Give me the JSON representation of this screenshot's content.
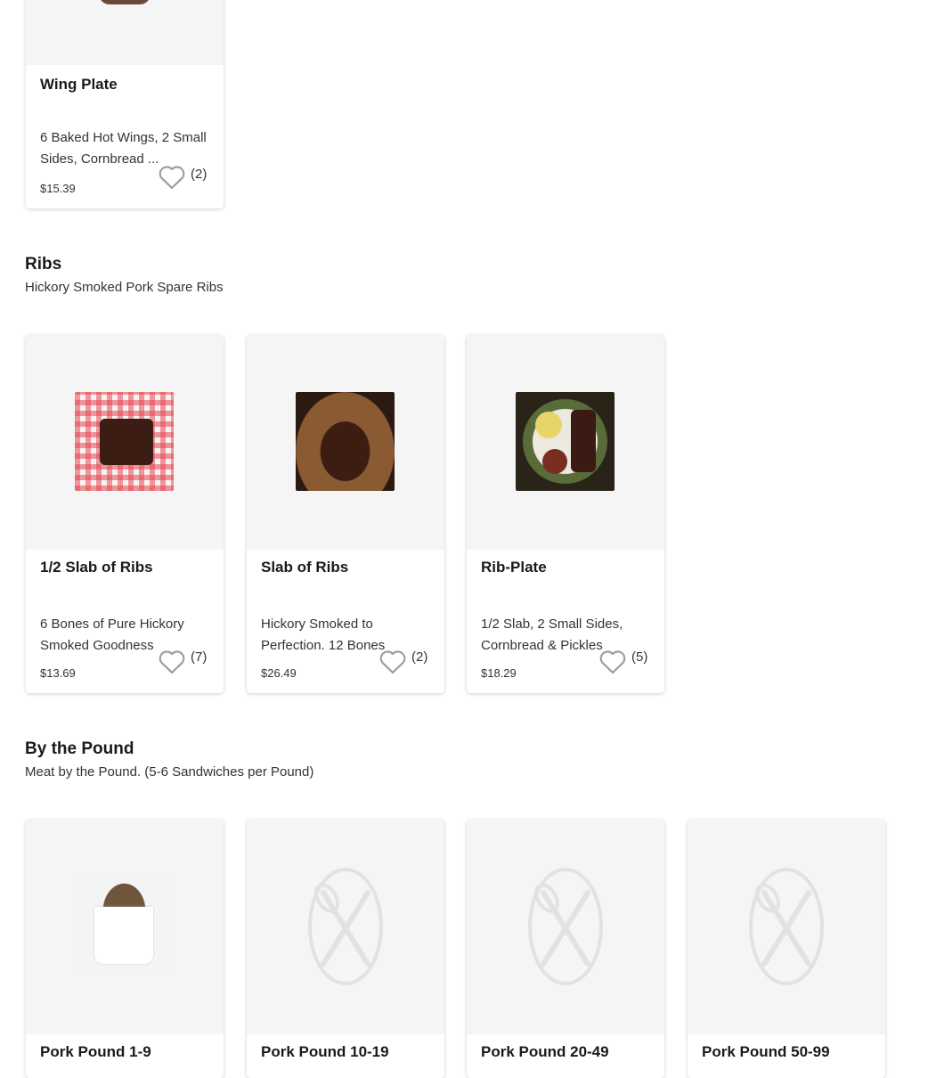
{
  "top_card": {
    "name": "Wing Plate",
    "description": "6 Baked Hot Wings, 2 Small Sides, Cornbread ...",
    "price": "$15.39",
    "favorites": "(2)"
  },
  "sections": [
    {
      "title": "Ribs",
      "subtitle": "Hickory Smoked Pork Spare Ribs",
      "items": [
        {
          "name": "1/2 Slab of Ribs",
          "description": "6 Bones of Pure Hickory Smoked Goodness",
          "price": "$13.69",
          "favorites": "(7)",
          "image": "ribs-tray-photo"
        },
        {
          "name": "Slab of Ribs",
          "description": "Hickory Smoked to Perfection. 12 Bones",
          "price": "$26.49",
          "favorites": "(2)",
          "image": "ribs-board-photo"
        },
        {
          "name": "Rib-Plate",
          "description": "1/2 Slab, 2 Small Sides, Cornbread & Pickles",
          "price": "$18.29",
          "favorites": "(5)",
          "image": "rib-plate-photo"
        }
      ]
    },
    {
      "title": "By the Pound",
      "subtitle": "Meat by the Pound. (5-6 Sandwiches per Pound)",
      "items": [
        {
          "name": "Pork Pound 1-9",
          "image": "pulled-pork-photo"
        },
        {
          "name": "Pork Pound 10-19",
          "image": "utensils-placeholder-icon"
        },
        {
          "name": "Pork Pound 20-49",
          "image": "utensils-placeholder-icon"
        },
        {
          "name": "Pork Pound 50-99",
          "image": "utensils-placeholder-icon"
        }
      ]
    }
  ],
  "colors": {
    "card_image_bg": "#f5f5f5",
    "text": "#1a1a1a",
    "heart_stroke": "#9e9e9e",
    "placeholder": "#e2e2e2"
  }
}
